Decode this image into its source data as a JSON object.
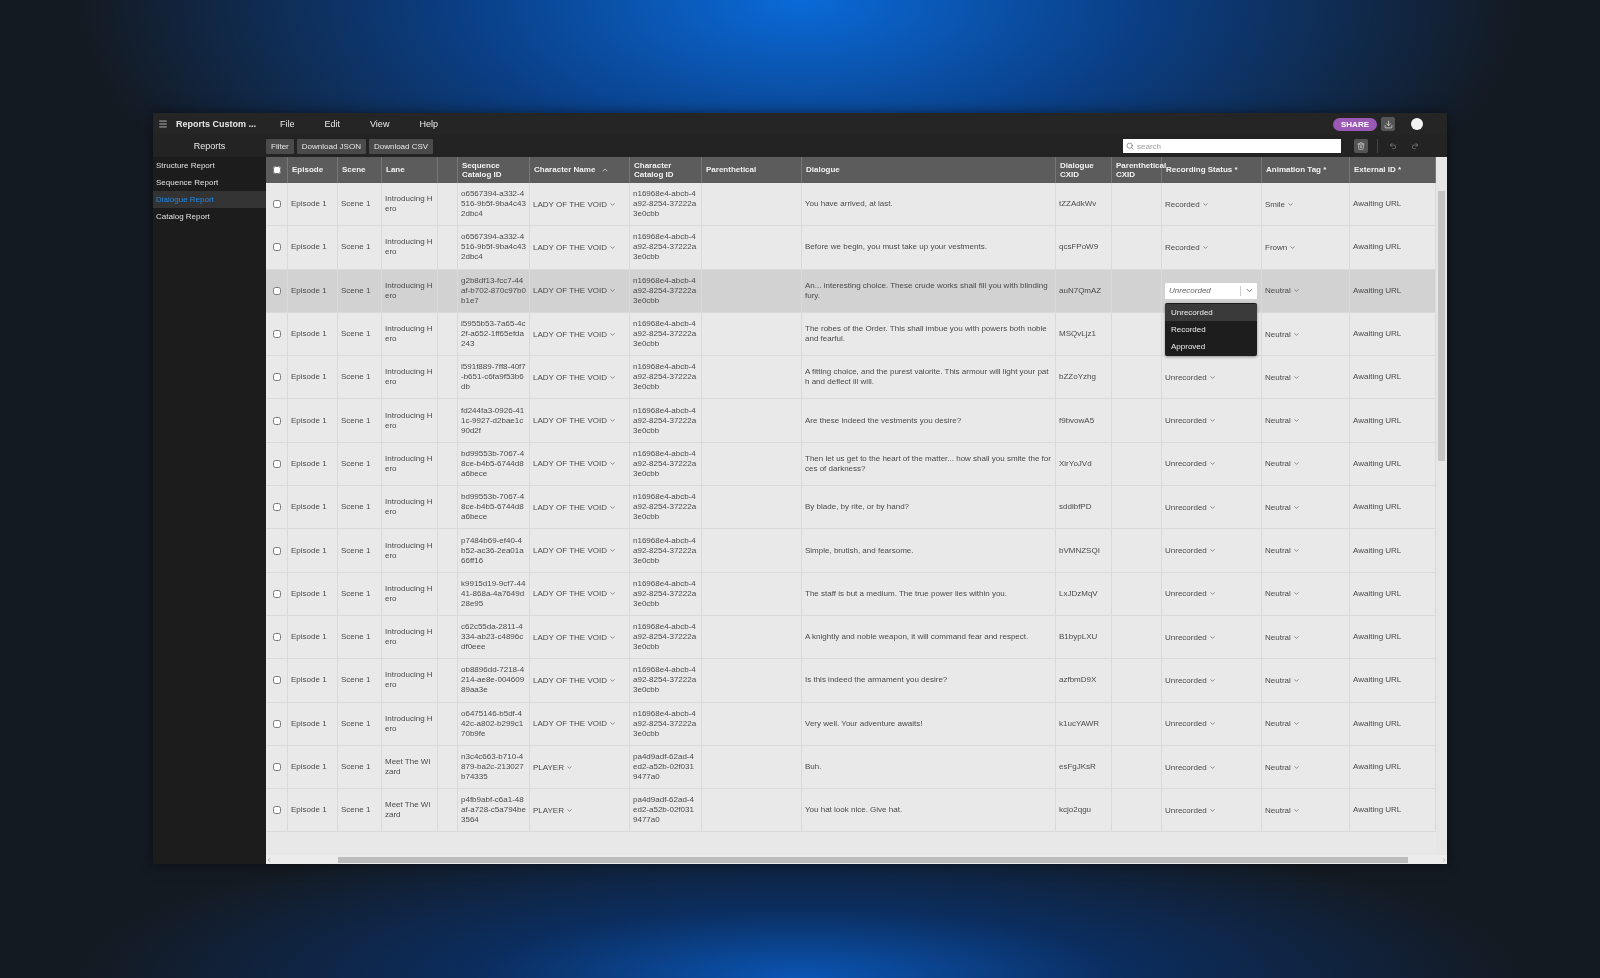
{
  "app": {
    "title": "Reports Custom ...",
    "menu": [
      "File",
      "Edit",
      "View",
      "Help"
    ],
    "share": "SHARE"
  },
  "sidebar": {
    "title": "Reports",
    "items": [
      {
        "label": "Structure Report",
        "selected": false
      },
      {
        "label": "Sequence Report",
        "selected": false
      },
      {
        "label": "Dialogue Report",
        "selected": true
      },
      {
        "label": "Catalog Report",
        "selected": false
      }
    ]
  },
  "toolbar": {
    "buttons": [
      "Filter",
      "Download JSON",
      "Download CSV"
    ],
    "search": {
      "placeholder": "search"
    }
  },
  "table": {
    "select_all": {
      "checked": false
    },
    "columns": [
      {
        "label": "Episode",
        "kind": "text"
      },
      {
        "label": "Scene",
        "kind": "text"
      },
      {
        "label": "Lane",
        "kind": "text"
      },
      {},
      {
        "label": "Sequence Catalog ID",
        "kind": "text"
      },
      {
        "label": "Character Name",
        "kind": "dropdown",
        "sorted_ascending": true
      },
      {
        "label": "Character Catalog ID",
        "kind": "text"
      },
      {
        "label": "Parenthetical"
      },
      {
        "label": "Dialogue",
        "kind": "text"
      },
      {
        "label": "Dialogue CXID",
        "kind": "text"
      },
      {
        "label": "Parenthetical CXID"
      },
      {
        "label": "Recording Status *",
        "kind": "dropdown"
      },
      {
        "label": "Animation Tag *",
        "kind": "dropdown"
      },
      {
        "label": "External ID *",
        "kind": "text"
      }
    ],
    "rows": [
      {
        "checked": false,
        "selected": false,
        "episode": "Episode 1",
        "scene": "Scene 1",
        "lane": "Introducing Hero",
        "sequence_catalog_id": "o6567394-a332-4516-9b5f-9ba4c432dbc4",
        "character_name": "LADY OF THE VOID",
        "character_catalog_id": "n16968e4-abcb-4a92-8254-37222a3e0cbb",
        "dialogue": "You have arrived, at last.",
        "dialogue_cxid": "tZZAdkWv",
        "recording_status": "Recorded",
        "animation_tag": "Smile",
        "external_id": "Awaiting URL"
      },
      {
        "checked": false,
        "selected": false,
        "episode": "Episode 1",
        "scene": "Scene 1",
        "lane": "Introducing Hero",
        "sequence_catalog_id": "o6567394-a332-4516-9b5f-9ba4c432dbc4",
        "character_name": "LADY OF THE VOID",
        "character_catalog_id": "n16968e4-abcb-4a92-8254-37222a3e0cbb",
        "dialogue": "Before we begin, you must take up your vestments.",
        "dialogue_cxid": "qcsFPoW9",
        "recording_status": "Recorded",
        "animation_tag": "Frown",
        "external_id": "Awaiting URL"
      },
      {
        "checked": false,
        "selected": true,
        "episode": "Episode 1",
        "scene": "Scene 1",
        "lane": "Introducing Hero",
        "sequence_catalog_id": "g2b8df13-fcc7-44af-b702-870c97b0b1e7",
        "character_name": "LADY OF THE VOID",
        "character_catalog_id": "n16968e4-abcb-4a92-8254-37222a3e0cbb",
        "dialogue": "An... interesting choice. These crude works shall fill you with blinding fury.",
        "dialogue_cxid": "auN7QmAZ",
        "recording_status": "Unrecorded",
        "status_menu": {
          "options": [
            {
              "label": "Unrecorded",
              "selected": true
            },
            {
              "label": "Recorded",
              "selected": false
            },
            {
              "label": "Approved",
              "selected": false
            }
          ]
        },
        "animation_tag": "Neutral",
        "external_id": "Awaiting URL"
      },
      {
        "checked": false,
        "selected": false,
        "episode": "Episode 1",
        "scene": "Scene 1",
        "lane": "Introducing Hero",
        "sequence_catalog_id": "l5955b53-7a65-4c2f-a652-1ff65efda243",
        "character_name": "LADY OF THE VOID",
        "character_catalog_id": "n16968e4-abcb-4a92-8254-37222a3e0cbb",
        "dialogue": "The robes of the Order. This shall imbue you with powers both noble and fearful.",
        "dialogue_cxid": "MSQvLjz1",
        "animation_tag": "Neutral",
        "external_id": "Awaiting URL"
      },
      {
        "checked": false,
        "selected": false,
        "episode": "Episode 1",
        "scene": "Scene 1",
        "lane": "Introducing Hero",
        "sequence_catalog_id": "l591f889-7ff8-40f7-b651-c6fa9f53b6db",
        "character_name": "LADY OF THE VOID",
        "character_catalog_id": "n16968e4-abcb-4a92-8254-37222a3e0cbb",
        "dialogue": "A fitting choice, and the purest valorite. This armour will light your path and deflect ill will.",
        "dialogue_cxid": "bZZoYzhg",
        "recording_status": "Unrecorded",
        "animation_tag": "Neutral",
        "external_id": "Awaiting URL"
      },
      {
        "checked": false,
        "selected": false,
        "episode": "Episode 1",
        "scene": "Scene 1",
        "lane": "Introducing Hero",
        "sequence_catalog_id": "fd244fa3-0926-411c-9927-d2bae1c90d2f",
        "character_name": "LADY OF THE VOID",
        "character_catalog_id": "n16968e4-abcb-4a92-8254-37222a3e0cbb",
        "dialogue": "Are these indeed the vestments you desire?",
        "dialogue_cxid": "f9bvowA5",
        "recording_status": "Unrecorded",
        "animation_tag": "Neutral",
        "external_id": "Awaiting URL"
      },
      {
        "checked": false,
        "selected": false,
        "episode": "Episode 1",
        "scene": "Scene 1",
        "lane": "Introducing Hero",
        "sequence_catalog_id": "bd99553b-7067-48ce-b4b5-6744d8a6bece",
        "character_name": "LADY OF THE VOID",
        "character_catalog_id": "n16968e4-abcb-4a92-8254-37222a3e0cbb",
        "dialogue": "Then let us get to the heart of the matter... how shall you smite the forces of darkness?",
        "dialogue_cxid": "XirYoJVd",
        "recording_status": "Unrecorded",
        "animation_tag": "Neutral",
        "external_id": "Awaiting URL"
      },
      {
        "checked": false,
        "selected": false,
        "episode": "Episode 1",
        "scene": "Scene 1",
        "lane": "Introducing Hero",
        "sequence_catalog_id": "bd99553b-7067-48ce-b4b5-6744d8a6bece",
        "character_name": "LADY OF THE VOID",
        "character_catalog_id": "n16968e4-abcb-4a92-8254-37222a3e0cbb",
        "dialogue": "By blade, by rite, or by hand?",
        "dialogue_cxid": "sddibfPD",
        "recording_status": "Unrecorded",
        "animation_tag": "Neutral",
        "external_id": "Awaiting URL"
      },
      {
        "checked": false,
        "selected": false,
        "episode": "Episode 1",
        "scene": "Scene 1",
        "lane": "Introducing Hero",
        "sequence_catalog_id": "p7484b69-ef40-4b52-ac36-2ea01a66ff16",
        "character_name": "LADY OF THE VOID",
        "character_catalog_id": "n16968e4-abcb-4a92-8254-37222a3e0cbb",
        "dialogue": "Simple, brutish, and fearsome.",
        "dialogue_cxid": "bVMNZSQI",
        "recording_status": "Unrecorded",
        "animation_tag": "Neutral",
        "external_id": "Awaiting URL"
      },
      {
        "checked": false,
        "selected": false,
        "episode": "Episode 1",
        "scene": "Scene 1",
        "lane": "Introducing Hero",
        "sequence_catalog_id": "k9915d19-9cf7-4441-868a-4a7649d28e95",
        "character_name": "LADY OF THE VOID",
        "character_catalog_id": "n16968e4-abcb-4a92-8254-37222a3e0cbb",
        "dialogue": "The staff is but a medium. The true power lies within you.",
        "dialogue_cxid": "LxJDzMqV",
        "recording_status": "Unrecorded",
        "animation_tag": "Neutral",
        "external_id": "Awaiting URL"
      },
      {
        "checked": false,
        "selected": false,
        "episode": "Episode 1",
        "scene": "Scene 1",
        "lane": "Introducing Hero",
        "sequence_catalog_id": "c62c55da-2811-4334-ab23-c4896cdf0eee",
        "character_name": "LADY OF THE VOID",
        "character_catalog_id": "n16968e4-abcb-4a92-8254-37222a3e0cbb",
        "dialogue": "A knightly and noble weapon, it will command fear and respect.",
        "dialogue_cxid": "B1bypLXU",
        "recording_status": "Unrecorded",
        "animation_tag": "Neutral",
        "external_id": "Awaiting URL"
      },
      {
        "checked": false,
        "selected": false,
        "episode": "Episode 1",
        "scene": "Scene 1",
        "lane": "Introducing Hero",
        "sequence_catalog_id": "ob8896dd-7218-4214-ae8e-00460989aa3e",
        "character_name": "LADY OF THE VOID",
        "character_catalog_id": "n16968e4-abcb-4a92-8254-37222a3e0cbb",
        "dialogue": "Is this indeed the armament you desire?",
        "dialogue_cxid": "azfbmD9X",
        "recording_status": "Unrecorded",
        "animation_tag": "Neutral",
        "external_id": "Awaiting URL"
      },
      {
        "checked": false,
        "selected": false,
        "episode": "Episode 1",
        "scene": "Scene 1",
        "lane": "Introducing Hero",
        "sequence_catalog_id": "o6475146-b5df-442c-a802-b299c170b9fe",
        "character_name": "LADY OF THE VOID",
        "character_catalog_id": "n16968e4-abcb-4a92-8254-37222a3e0cbb",
        "dialogue": "Very well. Your adventure awaits!",
        "dialogue_cxid": "k1ucYAWR",
        "recording_status": "Unrecorded",
        "animation_tag": "Neutral",
        "external_id": "Awaiting URL"
      },
      {
        "checked": false,
        "selected": false,
        "episode": "Episode 1",
        "scene": "Scene 1",
        "lane": "Meet The Wizard",
        "sequence_catalog_id": "n3c4c663-b710-4879-ba2c-213027b74335",
        "character_name": "PLAYER",
        "character_catalog_id": "pa4d9adf-62ad-4ed2-a52b-02f0319477a0",
        "dialogue": "Buh.",
        "dialogue_cxid": "esFgJKsR",
        "recording_status": "Unrecorded",
        "animation_tag": "Neutral",
        "external_id": "Awaiting URL"
      },
      {
        "checked": false,
        "selected": false,
        "episode": "Episode 1",
        "scene": "Scene 1",
        "lane": "Meet The Wizard",
        "sequence_catalog_id": "p4fb9abf-c6a1-48af-a728-c5a794be3564",
        "character_name": "PLAYER",
        "character_catalog_id": "pa4d9adf-62ad-4ed2-a52b-02f0319477a0",
        "dialogue": "You hat look nice. Give hat.",
        "dialogue_cxid": "kcjo2qgu",
        "recording_status": "Unrecorded",
        "animation_tag": "Neutral",
        "external_id": "Awaiting URL"
      }
    ]
  }
}
